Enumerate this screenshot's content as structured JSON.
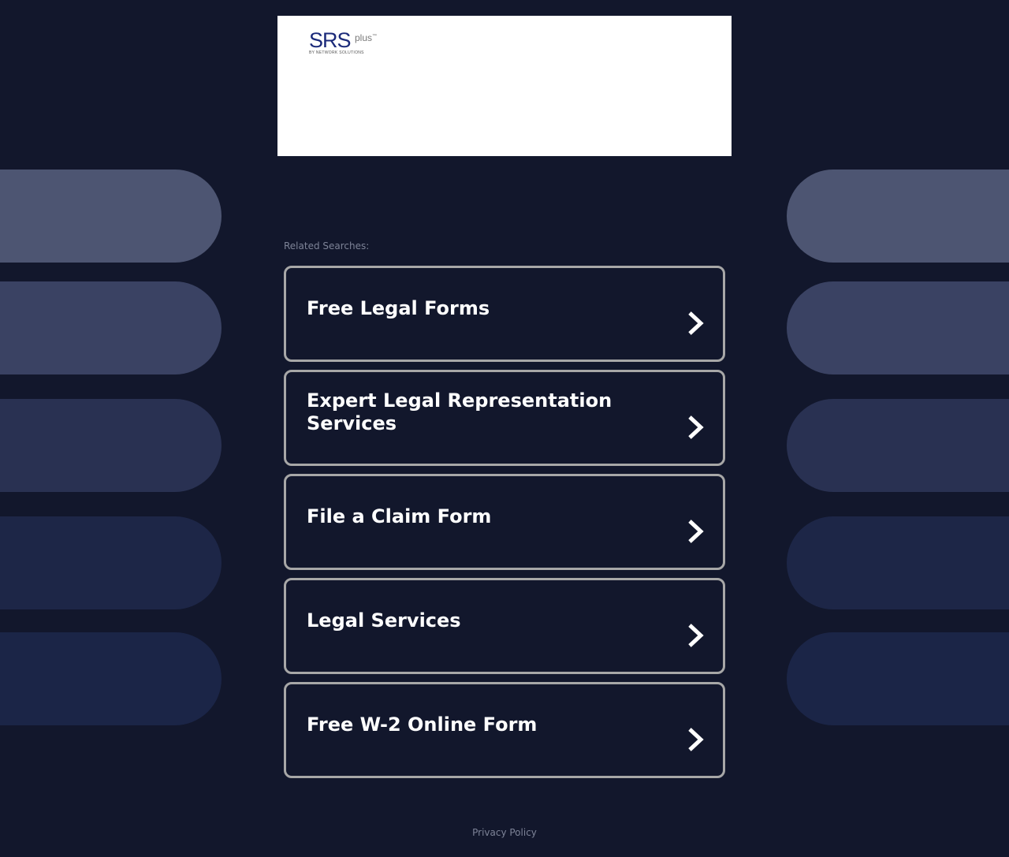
{
  "logo": {
    "main_text": "SRS",
    "super_text": "plus",
    "trademark": "™",
    "byline": "BY NETWORK SOLUTIONS"
  },
  "related_label": "Related Searches:",
  "searches": [
    {
      "label": "Free Legal Forms"
    },
    {
      "label": "Expert Legal Representation Services"
    },
    {
      "label": "File a Claim Form"
    },
    {
      "label": "Legal Services"
    },
    {
      "label": "Free W-2 Online Form"
    }
  ],
  "footer": {
    "privacy_label": "Privacy Policy"
  },
  "colors": {
    "background": "#12172c",
    "item_border": "#a7a7a7",
    "item_text": "#ffffff",
    "muted_text": "#7d8397",
    "logo_blue": "#1b2a7a"
  }
}
